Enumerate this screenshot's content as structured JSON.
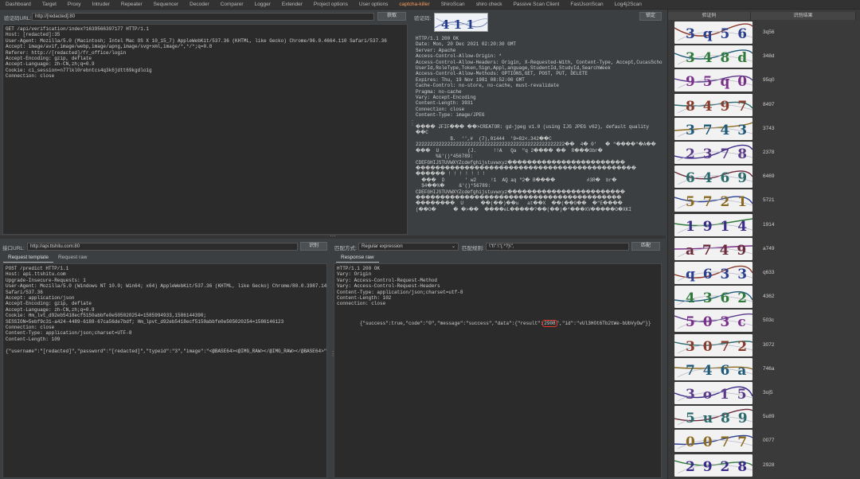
{
  "tabs": [
    "Dashboard",
    "Target",
    "Proxy",
    "Intruder",
    "Repeater",
    "Sequencer",
    "Decoder",
    "Comparer",
    "Logger",
    "Extender",
    "Project options",
    "User options",
    "captcha-killer",
    "ShiroScan",
    "shiro check",
    "Passive Scan Client",
    "FastJsonScan",
    "Log4j2Scan"
  ],
  "active_tab": "captcha-killer",
  "top_left": {
    "url_label": "验证码URL:",
    "url_value": "http://[redacted]:80",
    "fetch_button": "获取",
    "request_lines": [
      "GET /api/verification/index?1639566397177 HTTP/1.1",
      "Host: [redacted]:35",
      "User-Agent: Mozilla/5.0 (Macintosh; Intel Mac OS X 10_15_7) AppleWebKit/537.36 (KHTML, like Gecko) Chrome/96.0.4664.110 Safari/537.36",
      "Accept: image/avif,image/webp,image/apng,image/svg+xml,image/*,*/*;q=0.8",
      "Referer: http://[redacted]/fr_office/login",
      "Accept-Encoding: gzip, deflate",
      "Accept-Language: zh-CN,zh;q=0.9",
      "Cookie: ci_session=n77lkl0rebntcs4q3k6jdtt69kgdlo1g",
      "Connection: close"
    ]
  },
  "top_middle": {
    "captcha_label": "验证码:",
    "captcha_text": "4 1 1",
    "lock_button": "锁定",
    "response_lines": [
      "HTTP/1.1 200 OK",
      "Date: Mon, 20 Dec 2021 02:20:30 GMT",
      "Server: Apache",
      "Access-Control-Allow-Origin: *",
      "Access-Control-Allow-Headers: Origin, X-Requested-With, Content-Type, Accept,CucasSchoolId,",
      "UserId,RoleType,Token,Sign,Appl,anguage,StudentId,StudyId,SearchWeek",
      "Access-Control-Allow-Methods: OPTIONS,GET, POST, PUT, DELETE",
      "Expires: Thu, 19 Nov 1981 08:52:00 GMT",
      "Cache-Control: no-store, no-cache, must-revalidate",
      "Pragma: no-cache",
      "Vary: Accept-Encoding",
      "Content-Length: 3931",
      "Connection: close",
      "Content-Type: image/JPEG",
      "",
      "���� JFIF��� ��>CREATOR: gd-jpeg v1.0 (using IJG JPEG v62), default quality",
      "��C",
      "            $.  '',#  (7),01444  '9=82<.342��C",
      "2222222222222222222222222222222222222222222222222222��  4� 0'   � \"����\"�A��",
      "���  U          (J.      !!A   Qa  \"q 2���� ��  R���3br�",
      "       %&'()*456789:",
      "CDEFGHIJSTUVWXYZcdefghijstuvwxyz������������������������",
      "���������������������������������������������",
      "������ ! ! ! ! ! ! !",
      "  ���  D       ' w2     !1  AQ aq \"2� B����           #3R�  br�",
      "  $4��%�     &'()*56789:",
      "CDEFGHIJSTUVWXYZcdefghijstuvwxyz������������������������",
      "������������������������������������������",
      "��������  U      ��(��)��u   at��X  ��(��O��  �\"E����",
      "(��O�      � �>��  ����eL�����?��(��)�*���XV�����O�XKI"
    ]
  },
  "bottom_left": {
    "url_label": "接口URL:",
    "url_value": "http://api.ttshitu.com:80",
    "settings_button": "识别",
    "subtab_template": "Request template",
    "subtab_raw": "Request raw",
    "request_lines": [
      "POST /predict HTTP/1.1",
      "Host: api.ttshitu.com",
      "Upgrade-Insecure-Requests: 1",
      "User-Agent: Mozilla/5.0 (Windows NT 10.0; Win64; x64) AppleWebKit/537.36 (KHTML, like Gecko) Chrome/80.0.3987.149",
      "Safari/537.36",
      "Accept: application/json",
      "Accept-Encoding: gzip, deflate",
      "Accept-Language: zh-CN,zh;q=0.9",
      "Cookie: Hm_lvt_d92eb5418ecf5150abbfe0e505020254=1585994933,1586144390;",
      "SESSION=5ebf9c31-a424-4489-6188-67ca56de7bdf; Hm_lpvt_d92eb5418ecf5150abbfe0e505020254=1586146123",
      "Connection: close",
      "Content-Type: application/json;charset=UTF-8",
      "Content-Length: 109",
      "",
      "{\"username\":\"[redacted]\",\"password\":\"[redacted]\",\"typeid\":\"3\",\"image\":\"<@BASE64><@IMG_RAW></@IMG_RAW></@BASE64>\"}"
    ]
  },
  "bottom_right": {
    "match_label": "匹配方式:",
    "match_value": "Regular expression",
    "rule_label": "匹配规则:",
    "rule_value": "\\\"t\\\":\\\"(.*?)\\\",",
    "match_button": "匹配",
    "subtab_response": "Response raw",
    "response_lines": [
      "HTTP/1.1 200 OK",
      "Vary: Origin",
      "Vary: Access-Control-Request-Method",
      "Vary: Access-Control-Request-Headers",
      "Content-Type: application/json;charset=utf-8",
      "Content-Length: 102",
      "connection: close",
      ""
    ],
    "json_before": "{\"success\":true,\"code\":\"0\",\"message\":\"success\",\"data\":{\"result\":",
    "json_highlight": "2908",
    "json_after": "\",\"id\":\"vUl3HOt6Tb2tWe-bUbVyOw\"}}"
  },
  "results_table": {
    "col_captcha": "验证码",
    "col_result": "识别结果",
    "rows": [
      {
        "image_text": "3 q 5 6",
        "result": "3q56"
      },
      {
        "image_text": "3 4 8 d",
        "result": "348d"
      },
      {
        "image_text": "9 5 q 0",
        "result": "95q0"
      },
      {
        "image_text": "8 4 9 7",
        "result": "8497"
      },
      {
        "image_text": "3 7 4 3",
        "result": "3743"
      },
      {
        "image_text": "2 3 7 8",
        "result": "2378"
      },
      {
        "image_text": "6 4 6 9",
        "result": "6469"
      },
      {
        "image_text": "5 7 2 1",
        "result": "5721"
      },
      {
        "image_text": "1 9 1 4",
        "result": "1914"
      },
      {
        "image_text": "a 7 4 9",
        "result": "a749"
      },
      {
        "image_text": "q 6 3 3",
        "result": "q633"
      },
      {
        "image_text": "4 3 6 2",
        "result": "4362"
      },
      {
        "image_text": "5 0 3 c",
        "result": "503c"
      },
      {
        "image_text": "3 0 7 2",
        "result": "3072"
      },
      {
        "image_text": "7 4 6 a",
        "result": "746a"
      },
      {
        "image_text": "3 o 1 5",
        "result": "3o|5"
      },
      {
        "image_text": "5 u 8 9",
        "result": "5u89"
      },
      {
        "image_text": "0 0 7 7",
        "result": "0077"
      },
      {
        "image_text": "2 9 2 8",
        "result": "2928"
      }
    ]
  }
}
